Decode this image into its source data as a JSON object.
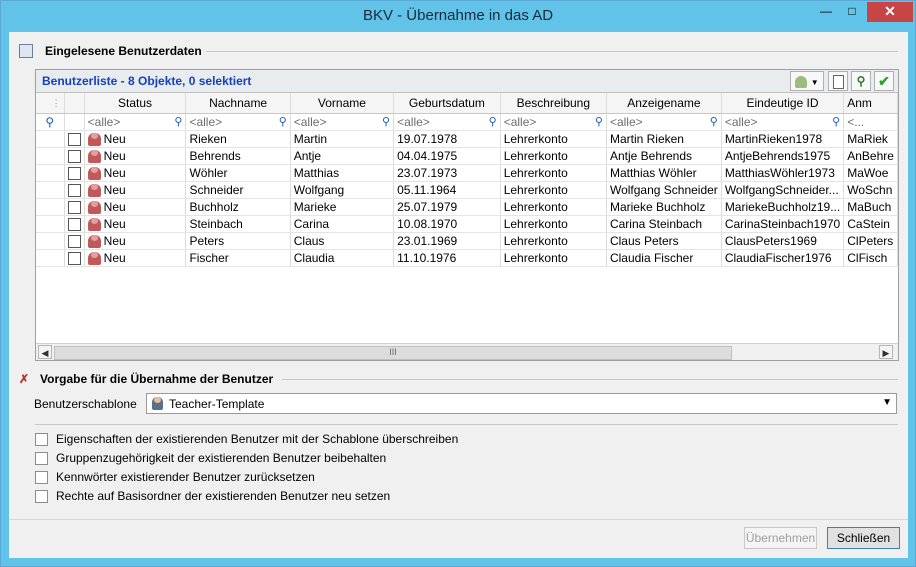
{
  "window": {
    "title": "BKV - Übernahme in das AD"
  },
  "section1": {
    "title": "Eingelesene Benutzerdaten"
  },
  "grid": {
    "title": "Benutzerliste - 8 Objekte, 0 selektiert",
    "columns": [
      "Status",
      "Nachname",
      "Vorname",
      "Geburtsdatum",
      "Beschreibung",
      "Anzeigename",
      "Eindeutige ID",
      "Anm"
    ],
    "filter": "<alle>",
    "filter_short": "<...",
    "rows": [
      {
        "status": "Neu",
        "nachname": "Rieken",
        "vorname": "Martin",
        "geb": "19.07.1978",
        "beschreibung": "Lehrerkonto",
        "anzeige": "Martin Rieken",
        "id": "MartinRieken1978",
        "anm": "MaRiek"
      },
      {
        "status": "Neu",
        "nachname": "Behrends",
        "vorname": "Antje",
        "geb": "04.04.1975",
        "beschreibung": "Lehrerkonto",
        "anzeige": "Antje Behrends",
        "id": "AntjeBehrends1975",
        "anm": "AnBehre"
      },
      {
        "status": "Neu",
        "nachname": "Wöhler",
        "vorname": "Matthias",
        "geb": "23.07.1973",
        "beschreibung": "Lehrerkonto",
        "anzeige": "Matthias Wöhler",
        "id": "MatthiasWöhler1973",
        "anm": "MaWoe"
      },
      {
        "status": "Neu",
        "nachname": "Schneider",
        "vorname": "Wolfgang",
        "geb": "05.11.1964",
        "beschreibung": "Lehrerkonto",
        "anzeige": "Wolfgang Schneider",
        "id": "WolfgangSchneider...",
        "anm": "WoSchn"
      },
      {
        "status": "Neu",
        "nachname": "Buchholz",
        "vorname": "Marieke",
        "geb": "25.07.1979",
        "beschreibung": "Lehrerkonto",
        "anzeige": "Marieke Buchholz",
        "id": "MariekeBuchholz19...",
        "anm": "MaBuch"
      },
      {
        "status": "Neu",
        "nachname": "Steinbach",
        "vorname": "Carina",
        "geb": "10.08.1970",
        "beschreibung": "Lehrerkonto",
        "anzeige": "Carina Steinbach",
        "id": "CarinaSteinbach1970",
        "anm": "CaStein"
      },
      {
        "status": "Neu",
        "nachname": "Peters",
        "vorname": "Claus",
        "geb": "23.01.1969",
        "beschreibung": "Lehrerkonto",
        "anzeige": "Claus Peters",
        "id": "ClausPeters1969",
        "anm": "ClPeters"
      },
      {
        "status": "Neu",
        "nachname": "Fischer",
        "vorname": "Claudia",
        "geb": "11.10.1976",
        "beschreibung": "Lehrerkonto",
        "anzeige": "Claudia Fischer",
        "id": "ClaudiaFischer1976",
        "anm": "ClFisch"
      }
    ],
    "scroll_thumb": "III"
  },
  "section2": {
    "title": "Vorgabe für die Übernahme der Benutzer"
  },
  "template": {
    "label": "Benutzerschablone",
    "value": "Teacher-Template"
  },
  "options": [
    "Eigenschaften der existierenden Benutzer mit der Schablone überschreiben",
    "Gruppenzugehörigkeit der existierenden Benutzer beibehalten",
    "Kennwörter existierender Benutzer zurücksetzen",
    "Rechte auf Basisordner der existierenden Benutzer neu setzen"
  ],
  "buttons": {
    "apply": "Übernehmen",
    "close": "Schließen"
  },
  "colors": {
    "titlebar": "#62c3e8",
    "grid_title": "#1540b8",
    "close_button": "#c74545"
  }
}
